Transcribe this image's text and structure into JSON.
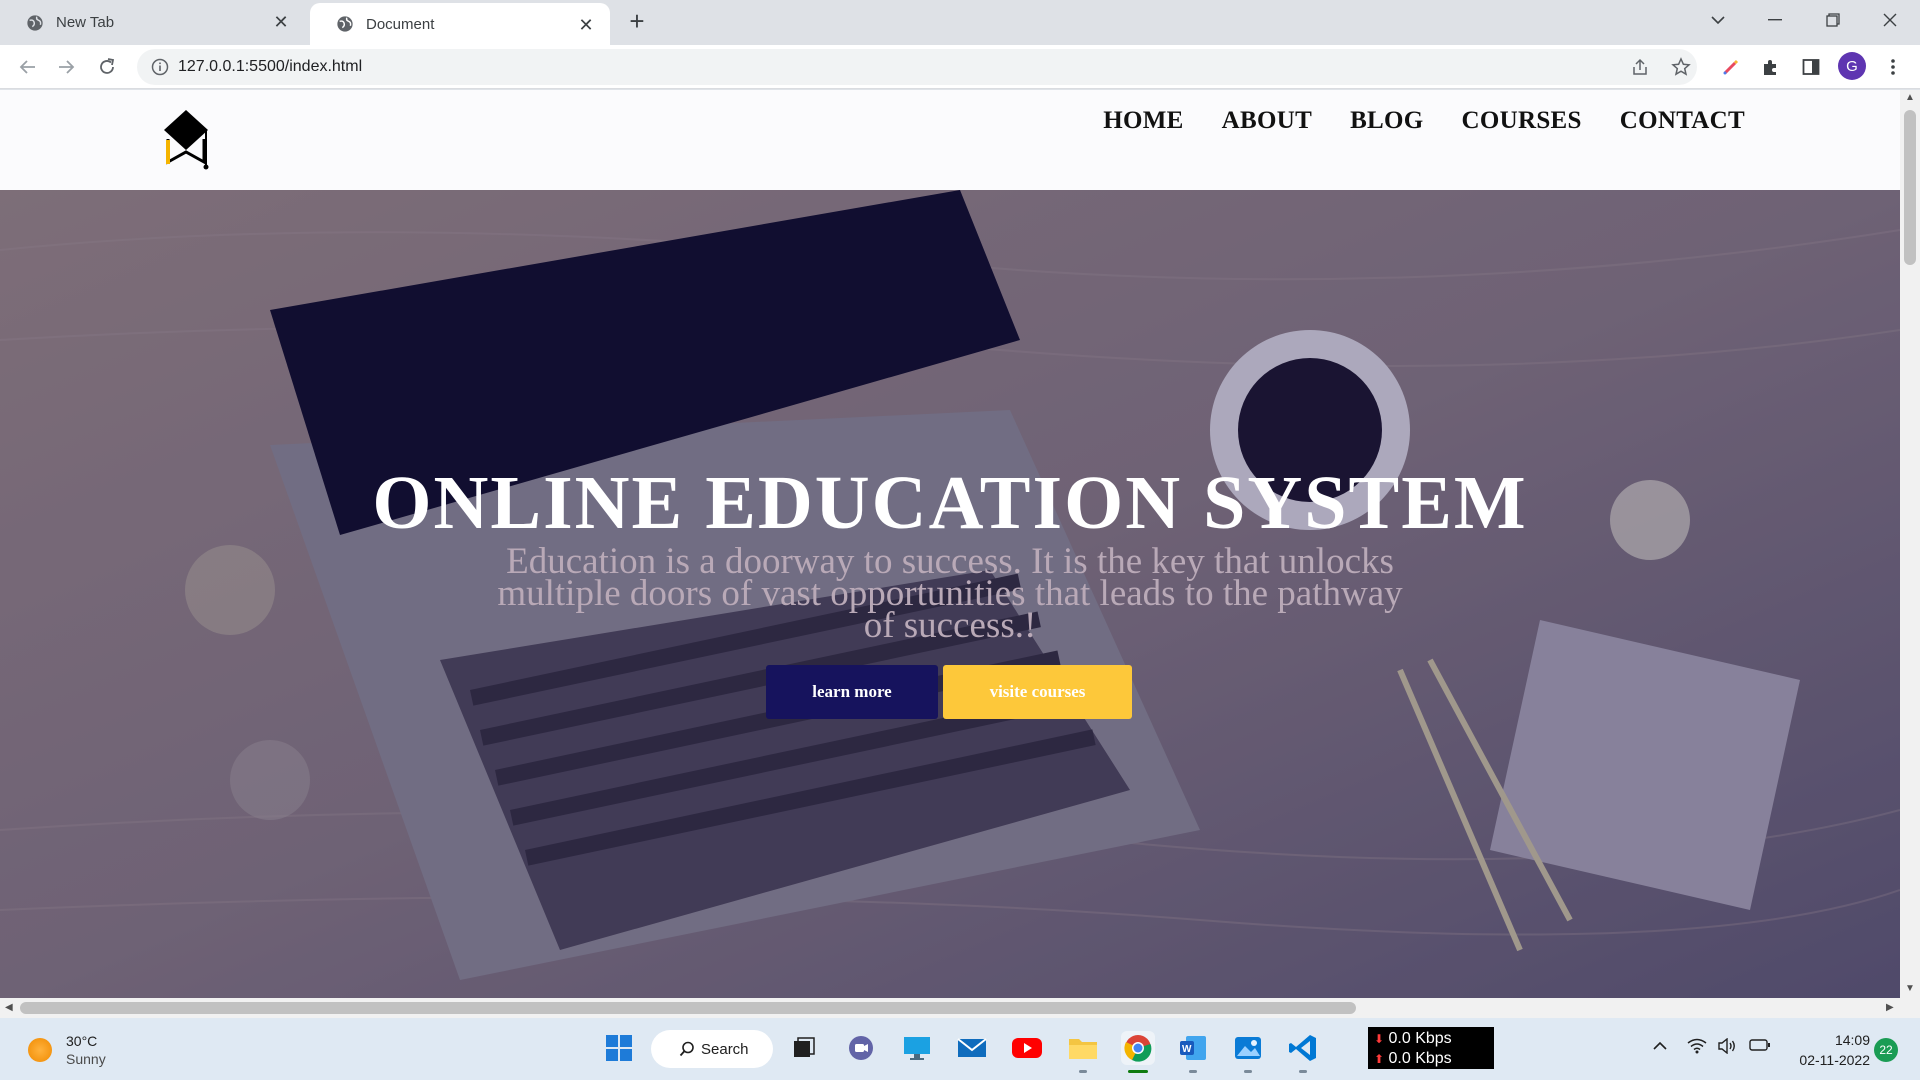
{
  "browser": {
    "tabs": [
      {
        "title": "New Tab",
        "active": false
      },
      {
        "title": "Document",
        "active": true
      }
    ],
    "url": "127.0.0.1:5500/index.html",
    "profile_initial": "G"
  },
  "site": {
    "nav": [
      "HOME",
      "ABOUT",
      "BLOG",
      "COURSES",
      "CONTACT"
    ],
    "hero": {
      "title": "ONLINE EDUCATION SYSTEM",
      "subtitle": "Education is a doorway to success. It is the key that unlocks multiple doors of vast opportunities that leads to the pathway of success.!",
      "learn_button": "learn more",
      "courses_button": "visite courses"
    },
    "colors": {
      "learn_button": "#16135d",
      "courses_button": "#fdc83a"
    }
  },
  "taskbar": {
    "weather_temp": "30°C",
    "weather_desc": "Sunny",
    "search_label": "Search",
    "net_down": "0.0 Kbps",
    "net_up": "0.0 Kbps",
    "time": "14:09",
    "date": "02-11-2022",
    "notification_count": "22"
  }
}
